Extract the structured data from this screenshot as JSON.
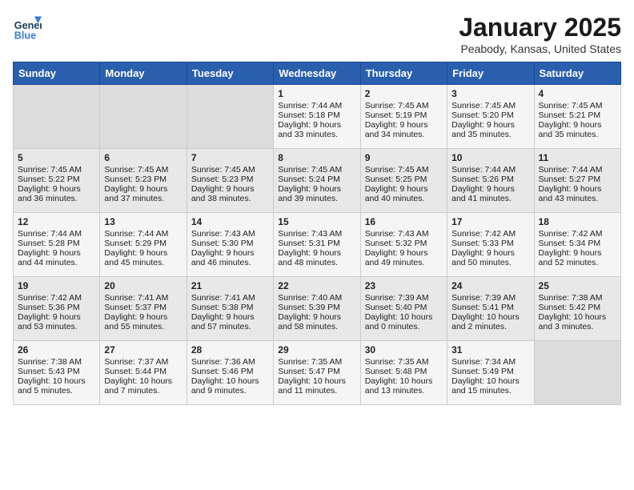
{
  "header": {
    "logo_general": "General",
    "logo_blue": "Blue",
    "title": "January 2025",
    "subtitle": "Peabody, Kansas, United States"
  },
  "days_of_week": [
    "Sunday",
    "Monday",
    "Tuesday",
    "Wednesday",
    "Thursday",
    "Friday",
    "Saturday"
  ],
  "weeks": [
    [
      {
        "day": "",
        "content": ""
      },
      {
        "day": "",
        "content": ""
      },
      {
        "day": "",
        "content": ""
      },
      {
        "day": "1",
        "content": "Sunrise: 7:44 AM\nSunset: 5:18 PM\nDaylight: 9 hours\nand 33 minutes."
      },
      {
        "day": "2",
        "content": "Sunrise: 7:45 AM\nSunset: 5:19 PM\nDaylight: 9 hours\nand 34 minutes."
      },
      {
        "day": "3",
        "content": "Sunrise: 7:45 AM\nSunset: 5:20 PM\nDaylight: 9 hours\nand 35 minutes."
      },
      {
        "day": "4",
        "content": "Sunrise: 7:45 AM\nSunset: 5:21 PM\nDaylight: 9 hours\nand 35 minutes."
      }
    ],
    [
      {
        "day": "5",
        "content": "Sunrise: 7:45 AM\nSunset: 5:22 PM\nDaylight: 9 hours\nand 36 minutes."
      },
      {
        "day": "6",
        "content": "Sunrise: 7:45 AM\nSunset: 5:23 PM\nDaylight: 9 hours\nand 37 minutes."
      },
      {
        "day": "7",
        "content": "Sunrise: 7:45 AM\nSunset: 5:23 PM\nDaylight: 9 hours\nand 38 minutes."
      },
      {
        "day": "8",
        "content": "Sunrise: 7:45 AM\nSunset: 5:24 PM\nDaylight: 9 hours\nand 39 minutes."
      },
      {
        "day": "9",
        "content": "Sunrise: 7:45 AM\nSunset: 5:25 PM\nDaylight: 9 hours\nand 40 minutes."
      },
      {
        "day": "10",
        "content": "Sunrise: 7:44 AM\nSunset: 5:26 PM\nDaylight: 9 hours\nand 41 minutes."
      },
      {
        "day": "11",
        "content": "Sunrise: 7:44 AM\nSunset: 5:27 PM\nDaylight: 9 hours\nand 43 minutes."
      }
    ],
    [
      {
        "day": "12",
        "content": "Sunrise: 7:44 AM\nSunset: 5:28 PM\nDaylight: 9 hours\nand 44 minutes."
      },
      {
        "day": "13",
        "content": "Sunrise: 7:44 AM\nSunset: 5:29 PM\nDaylight: 9 hours\nand 45 minutes."
      },
      {
        "day": "14",
        "content": "Sunrise: 7:43 AM\nSunset: 5:30 PM\nDaylight: 9 hours\nand 46 minutes."
      },
      {
        "day": "15",
        "content": "Sunrise: 7:43 AM\nSunset: 5:31 PM\nDaylight: 9 hours\nand 48 minutes."
      },
      {
        "day": "16",
        "content": "Sunrise: 7:43 AM\nSunset: 5:32 PM\nDaylight: 9 hours\nand 49 minutes."
      },
      {
        "day": "17",
        "content": "Sunrise: 7:42 AM\nSunset: 5:33 PM\nDaylight: 9 hours\nand 50 minutes."
      },
      {
        "day": "18",
        "content": "Sunrise: 7:42 AM\nSunset: 5:34 PM\nDaylight: 9 hours\nand 52 minutes."
      }
    ],
    [
      {
        "day": "19",
        "content": "Sunrise: 7:42 AM\nSunset: 5:36 PM\nDaylight: 9 hours\nand 53 minutes."
      },
      {
        "day": "20",
        "content": "Sunrise: 7:41 AM\nSunset: 5:37 PM\nDaylight: 9 hours\nand 55 minutes."
      },
      {
        "day": "21",
        "content": "Sunrise: 7:41 AM\nSunset: 5:38 PM\nDaylight: 9 hours\nand 57 minutes."
      },
      {
        "day": "22",
        "content": "Sunrise: 7:40 AM\nSunset: 5:39 PM\nDaylight: 9 hours\nand 58 minutes."
      },
      {
        "day": "23",
        "content": "Sunrise: 7:39 AM\nSunset: 5:40 PM\nDaylight: 10 hours\nand 0 minutes."
      },
      {
        "day": "24",
        "content": "Sunrise: 7:39 AM\nSunset: 5:41 PM\nDaylight: 10 hours\nand 2 minutes."
      },
      {
        "day": "25",
        "content": "Sunrise: 7:38 AM\nSunset: 5:42 PM\nDaylight: 10 hours\nand 3 minutes."
      }
    ],
    [
      {
        "day": "26",
        "content": "Sunrise: 7:38 AM\nSunset: 5:43 PM\nDaylight: 10 hours\nand 5 minutes."
      },
      {
        "day": "27",
        "content": "Sunrise: 7:37 AM\nSunset: 5:44 PM\nDaylight: 10 hours\nand 7 minutes."
      },
      {
        "day": "28",
        "content": "Sunrise: 7:36 AM\nSunset: 5:46 PM\nDaylight: 10 hours\nand 9 minutes."
      },
      {
        "day": "29",
        "content": "Sunrise: 7:35 AM\nSunset: 5:47 PM\nDaylight: 10 hours\nand 11 minutes."
      },
      {
        "day": "30",
        "content": "Sunrise: 7:35 AM\nSunset: 5:48 PM\nDaylight: 10 hours\nand 13 minutes."
      },
      {
        "day": "31",
        "content": "Sunrise: 7:34 AM\nSunset: 5:49 PM\nDaylight: 10 hours\nand 15 minutes."
      },
      {
        "day": "",
        "content": ""
      }
    ]
  ]
}
